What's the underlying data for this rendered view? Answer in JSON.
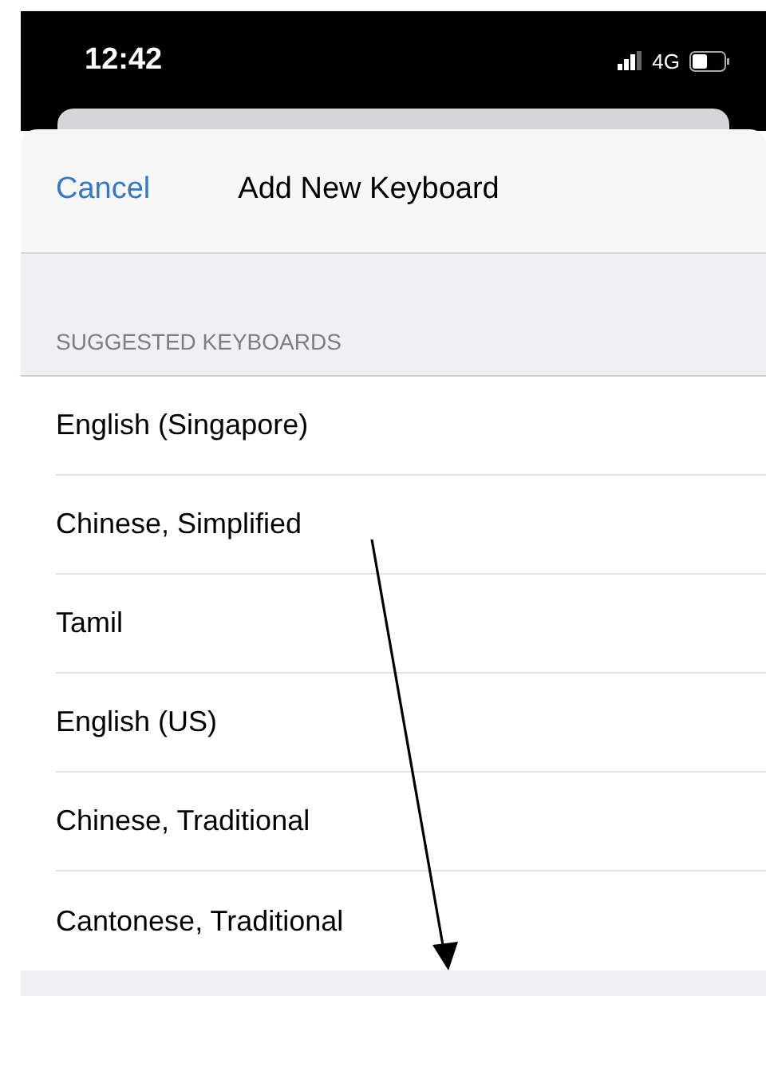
{
  "status_bar": {
    "time": "12:42",
    "network": "4G"
  },
  "nav": {
    "cancel": "Cancel",
    "title": "Add New Keyboard"
  },
  "section": {
    "header": "SUGGESTED KEYBOARDS",
    "items": [
      {
        "label": "English (Singapore)"
      },
      {
        "label": "Chinese, Simplified"
      },
      {
        "label": "Tamil"
      },
      {
        "label": "English (US)"
      },
      {
        "label": "Chinese, Traditional"
      },
      {
        "label": "Cantonese, Traditional"
      }
    ]
  }
}
